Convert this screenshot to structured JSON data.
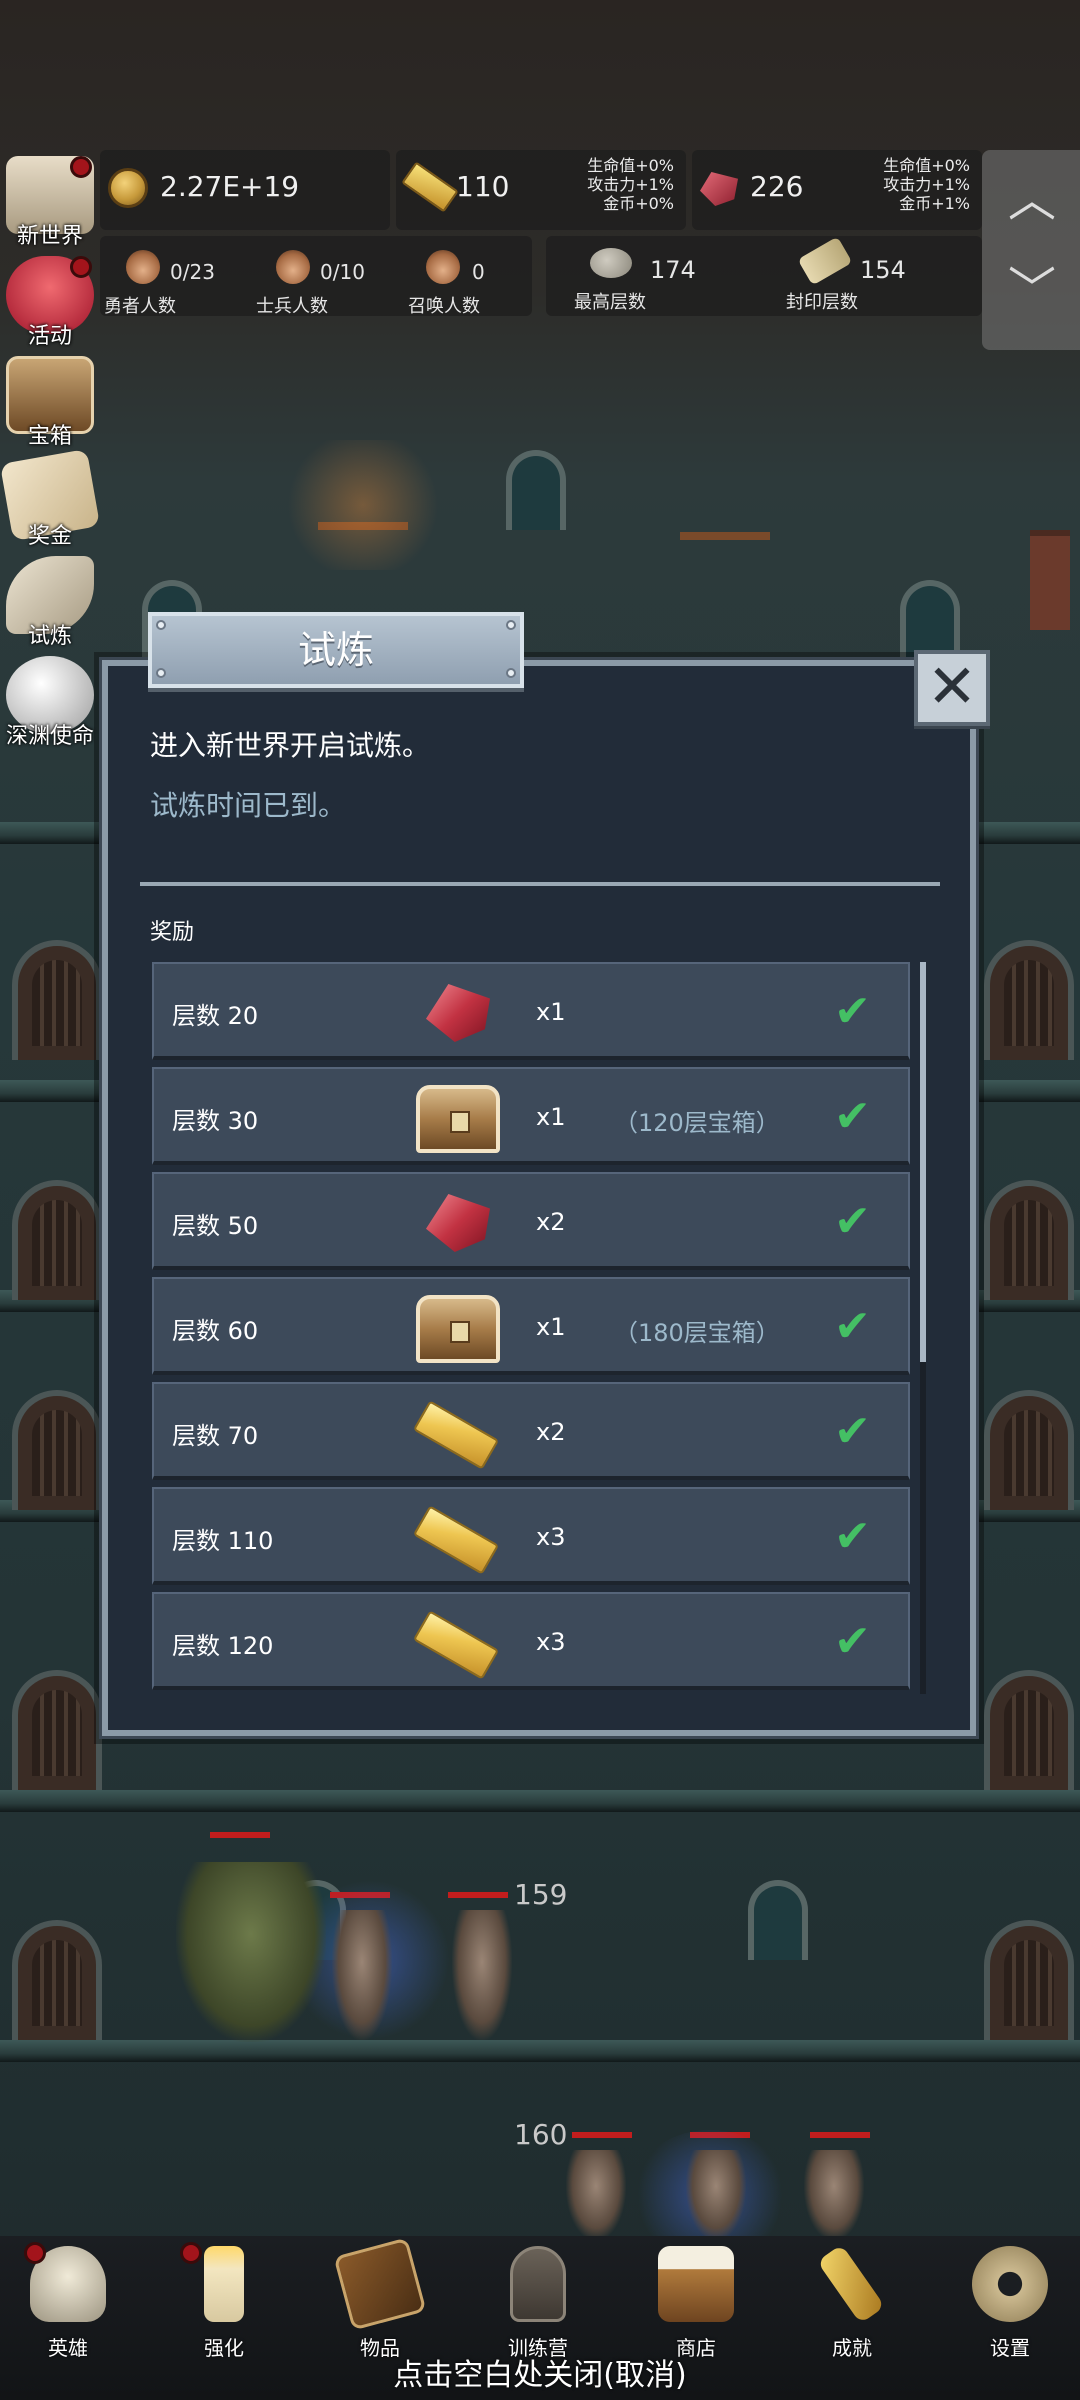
{
  "hud": {
    "gold": "2.27E+19",
    "gold_bars": "110",
    "gold_bar_bonus": [
      "生命值+0%",
      "攻击力+1%",
      "金币+0%"
    ],
    "gems": "226",
    "gem_bonus": [
      "生命值+0%",
      "攻击力+1%",
      "金币+1%"
    ],
    "heroes": {
      "value": "0/23",
      "label": "勇者人数"
    },
    "soldiers": {
      "value": "0/10",
      "label": "士兵人数"
    },
    "summons": {
      "value": "0",
      "label": "召唤人数"
    },
    "max_floor": {
      "value": "174",
      "label": "最高层数"
    },
    "sealed_floor": {
      "value": "154",
      "label": "封印层数"
    }
  },
  "side_menu": [
    {
      "label": "新世界",
      "icon": "castle-map-icon",
      "dot": true
    },
    {
      "label": "活动",
      "icon": "heart-icon",
      "dot": true
    },
    {
      "label": "宝箱",
      "icon": "chest-icon",
      "dot": false
    },
    {
      "label": "奖金",
      "icon": "letter-icon",
      "dot": false
    },
    {
      "label": "试炼",
      "icon": "horn-icon",
      "dot": false
    },
    {
      "label": "深渊使命",
      "icon": "orb-icon",
      "dot": false
    }
  ],
  "dialog": {
    "title": "试炼",
    "close": "✕",
    "line1": "进入新世界开启试炼。",
    "line2": "试炼时间已到。",
    "rewards_label": "奖励",
    "rows": [
      {
        "floor": "层数 20",
        "item": "gem",
        "qty": "x1",
        "note": ""
      },
      {
        "floor": "层数 30",
        "item": "chest",
        "qty": "x1",
        "note": "（120层宝箱）"
      },
      {
        "floor": "层数 50",
        "item": "gem",
        "qty": "x2",
        "note": ""
      },
      {
        "floor": "层数 60",
        "item": "chest",
        "qty": "x1",
        "note": "（180层宝箱）"
      },
      {
        "floor": "层数 70",
        "item": "bar",
        "qty": "x2",
        "note": ""
      },
      {
        "floor": "层数 110",
        "item": "bar",
        "qty": "x3",
        "note": ""
      },
      {
        "floor": "层数 120",
        "item": "bar",
        "qty": "x3",
        "note": ""
      }
    ]
  },
  "scene": {
    "floor_a": "159",
    "floor_b": "160"
  },
  "bottom_nav": [
    {
      "label": "英雄",
      "icon": "skull-icon",
      "dot": true
    },
    {
      "label": "强化",
      "icon": "candle-icon",
      "dot": true
    },
    {
      "label": "物品",
      "icon": "book-icon",
      "dot": false
    },
    {
      "label": "训练营",
      "icon": "lantern-icon",
      "dot": false
    },
    {
      "label": "商店",
      "icon": "beer-mug-icon",
      "dot": false
    },
    {
      "label": "成就",
      "icon": "key-icon",
      "dot": false
    },
    {
      "label": "设置",
      "icon": "gear-icon",
      "dot": false
    }
  ],
  "close_hint": "点击空白处关闭(取消)",
  "colors": {
    "panel": "#222c39",
    "row": "#3d4a5a",
    "accent_text": "#9db9cb",
    "check": "#44c064"
  }
}
